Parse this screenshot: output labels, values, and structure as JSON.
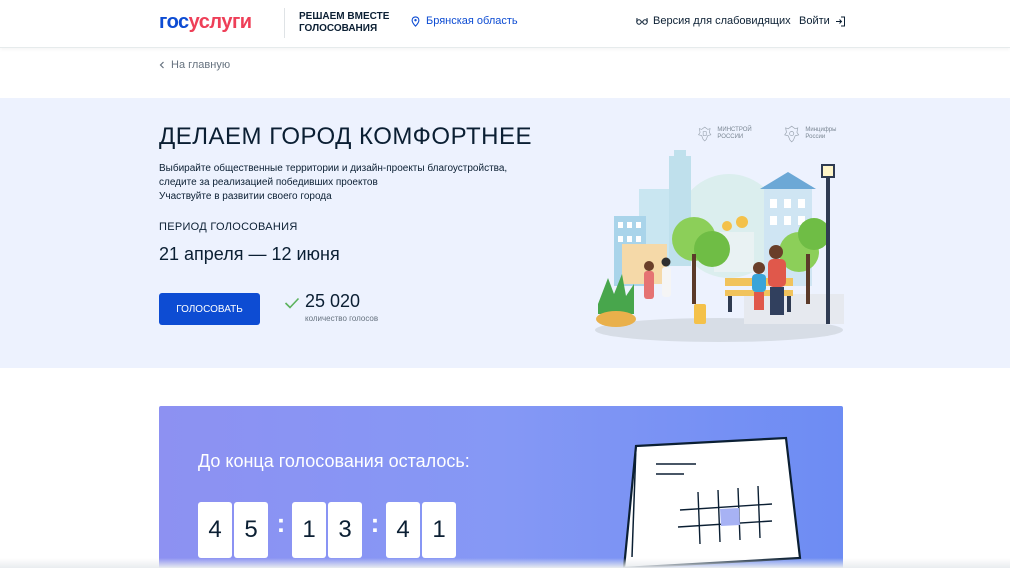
{
  "header": {
    "logo_part1": "гос",
    "logo_part2": "услуги",
    "project_title": "РЕШАЕМ ВМЕСТЕ ГОЛОСОВАНИЯ",
    "region": "Брянская область",
    "accessibility": "Версия для слабовидящих",
    "login": "Войти"
  },
  "breadcrumb": {
    "back_label": "На главную"
  },
  "hero": {
    "title": "ДЕЛАЕМ ГОРОД КОМФОРТНЕЕ",
    "desc_line1": "Выбирайте общественные территории и дизайн-проекты благоустройства,",
    "desc_line2": "следите за реализацией победивших проектов",
    "desc_line3": "Участвуйте в развитии своего города",
    "period_label": "ПЕРИОД ГОЛОСОВАНИЯ",
    "period_dates": "21 апреля — 12 июня",
    "vote_button": "ГОЛОСОВАТЬ",
    "votes_count": "25 020",
    "votes_label": "количество голосов",
    "ministry1": "МИНСТРОЙ РОССИИ",
    "ministry2": "Минцифры России"
  },
  "countdown": {
    "title": "До конца голосования осталось:",
    "digits": [
      "4",
      "5",
      "1",
      "3",
      "4",
      "1"
    ],
    "separator": ":"
  },
  "colors": {
    "brand_blue": "#0d4cd3",
    "brand_red": "#ee3f58",
    "hero_bg": "#edf2fe",
    "countdown_bg": "#8598f5"
  },
  "icons": [
    "location-pin-icon",
    "glasses-icon",
    "login-icon",
    "chevron-left-icon",
    "check-icon",
    "emblem-icon",
    "calendar-illustration",
    "city-illustration"
  ]
}
